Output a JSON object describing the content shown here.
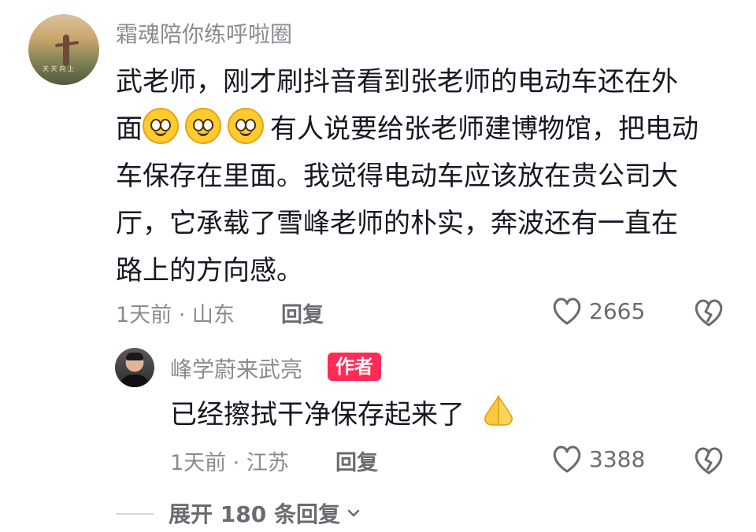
{
  "comment": {
    "username": "霜魂陪你练呼啦圈",
    "lines": [
      "武老师，刚才刷抖音看到张老师的电动车还在外",
      "有人说要给张老师建博物馆，把电动",
      "车保存在里面。我觉得电动车应该放在贵公司大",
      "厅，它承载了雪峰老师的朴实，奔波还有一直在",
      "路上的方向感。"
    ],
    "line2_prefix": "面",
    "time_location": "1天前 · 山东",
    "reply_label": "回复",
    "likes": "2665",
    "avatar_watermark": "天 天 向 上"
  },
  "reply": {
    "username": "峰学蔚来武亮",
    "badge": "作者",
    "text": "已经擦拭干净保存起来了",
    "time_location": "1天前 · 江苏",
    "reply_label": "回复",
    "likes": "3388"
  },
  "expand": {
    "label": "展开 180 条回复"
  },
  "icons": {
    "like": "heart-icon",
    "dislike": "broken-heart-icon",
    "emoji": "smile-emoji-icon",
    "pray": "pray-hands-icon",
    "expand": "chevron-down-icon"
  },
  "colors": {
    "author_badge": "#fe2c55",
    "meta_gray": "#8a8b91"
  }
}
